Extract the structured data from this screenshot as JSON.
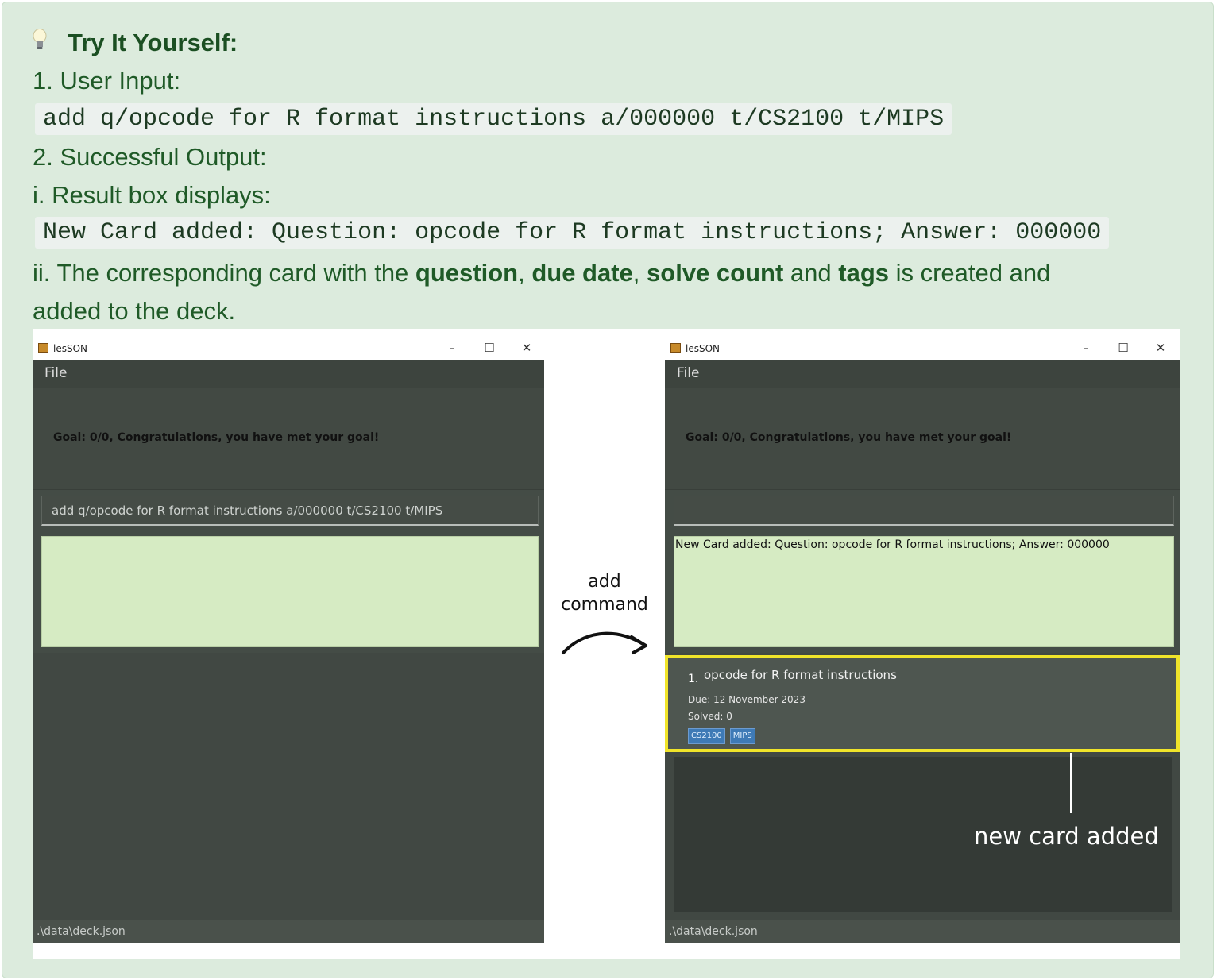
{
  "callout": {
    "icon": "lightbulb-icon",
    "heading": "Try It Yourself:",
    "step1": "1. User Input:",
    "command_code": "add q/opcode for R format instructions a/000000 t/CS2100 t/MIPS",
    "step2": "2. Successful Output:",
    "step2_i": "i. Result box displays:",
    "result_code": "New Card added: Question: opcode for R format instructions; Answer: 000000",
    "step2_ii": {
      "p1": "ii. The corresponding card with the ",
      "b1": "question",
      "p2": ", ",
      "b2": "due date",
      "p3": ", ",
      "b3": "solve count",
      "p4": " and ",
      "b4": "tags",
      "p5": " is created and",
      "line2": "added to the deck."
    }
  },
  "window_before": {
    "title": "lesSON",
    "menu_file": "File",
    "goal_text": "Goal: 0/0, Congratulations, you have met your goal!",
    "command_value": "add q/opcode for R format instructions a/000000 t/CS2100 t/MIPS",
    "result_text": "",
    "status_path": ".\\data\\deck.json"
  },
  "arrow": {
    "label_line1": "add",
    "label_line2": "command"
  },
  "window_after": {
    "title": "lesSON",
    "menu_file": "File",
    "goal_text": "Goal: 0/0, Congratulations, you have met your goal!",
    "command_value": "",
    "result_text": "New Card added: Question: opcode for R format instructions; Answer: 000000",
    "status_path": ".\\data\\deck.json",
    "card": {
      "index": "1.",
      "question": "opcode for R format instructions",
      "due": "Due: 12 November 2023",
      "solved": "Solved: 0",
      "tags": [
        "CS2100",
        "MIPS"
      ]
    },
    "annotation": "new card added",
    "highlight_color": "#f0e42a"
  },
  "window_controls": {
    "minimize": "–",
    "maximize": "☐",
    "close": "✕"
  }
}
